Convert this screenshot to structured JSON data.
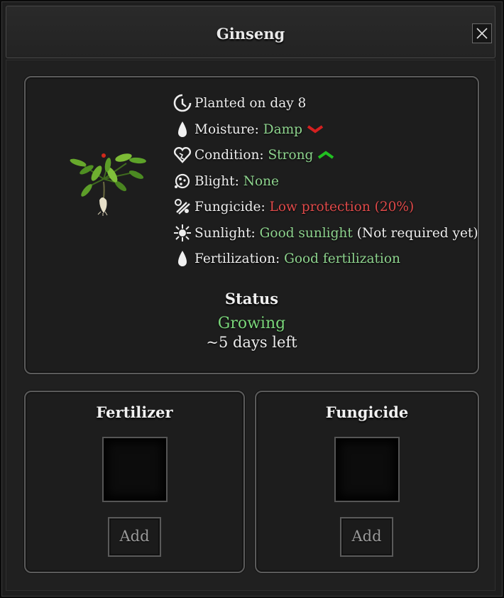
{
  "window": {
    "title": "Ginseng",
    "close_icon": "close-icon"
  },
  "plant": {
    "icon": "ginseng-plant-icon"
  },
  "stats": {
    "planted": {
      "icon": "clock-icon",
      "text": "Planted on day 8"
    },
    "moisture": {
      "icon": "water-drop-icon",
      "label": "Moisture:",
      "value": "Damp",
      "trend": "down",
      "trend_color": "#d42020"
    },
    "condition": {
      "icon": "heart-icon",
      "label": "Condition:",
      "value": "Strong",
      "trend": "up",
      "trend_color": "#21c021"
    },
    "blight": {
      "icon": "blight-icon",
      "label": "Blight:",
      "value": "None"
    },
    "fungicide": {
      "icon": "fungicide-icon",
      "label": "Fungicide:",
      "value": "Low protection (20%)"
    },
    "sunlight": {
      "icon": "sun-icon",
      "label": "Sunlight:",
      "value": "Good sunlight",
      "note": "(Not required yet)"
    },
    "fertilization": {
      "icon": "fertilizer-drop-icon",
      "label": "Fertilization:",
      "value": "Good fertilization"
    }
  },
  "status": {
    "title": "Status",
    "value": "Growing",
    "days_left": "~5 days left"
  },
  "fertilizer": {
    "title": "Fertilizer",
    "add_label": "Add"
  },
  "fungicide_section": {
    "title": "Fungicide",
    "add_label": "Add"
  },
  "colors": {
    "good": "#8ed48e",
    "bad": "#e04a4a"
  }
}
